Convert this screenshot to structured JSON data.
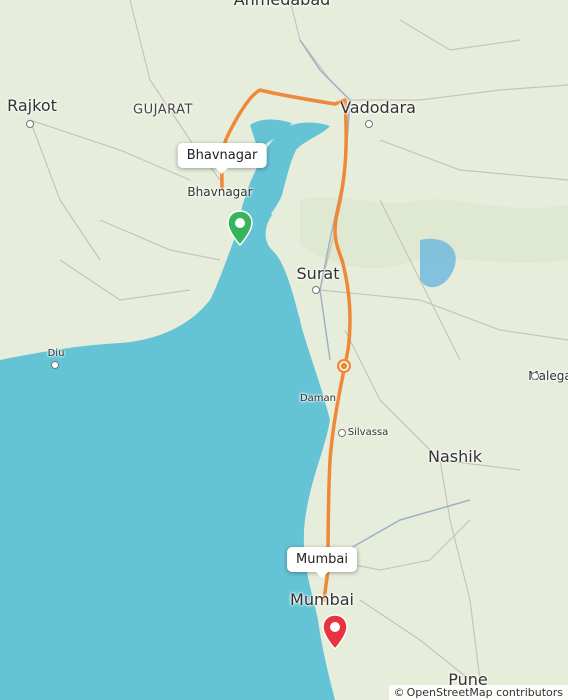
{
  "map": {
    "colors": {
      "land": "#e6eedb",
      "sea": "#64c3d4",
      "road": "#c9c3b6",
      "route": "#f0883a",
      "start_marker": "#36b35b",
      "end_marker": "#e8343f"
    },
    "places": {
      "ahmedabad": "Ahmedabad",
      "rajkot": "Rajkot",
      "gujarat": "GUJARAT",
      "vadodara": "Vadodara",
      "bhavnagar": "Bhavnagar",
      "surat": "Surat",
      "diu": "Diu",
      "daman": "Daman",
      "silvassa": "Silvassa",
      "nashik": "Nashik",
      "malegaon": "Malega",
      "mumbai": "Mumbai",
      "pune": "Pune"
    },
    "start": {
      "label": "Bhavnagar",
      "icon": "map-pin-icon"
    },
    "end": {
      "label": "Mumbai",
      "icon": "map-pin-icon"
    },
    "toll_icon": "toll-icon",
    "attribution": {
      "symbol": "©",
      "text": "OpenStreetMap contributors"
    }
  }
}
